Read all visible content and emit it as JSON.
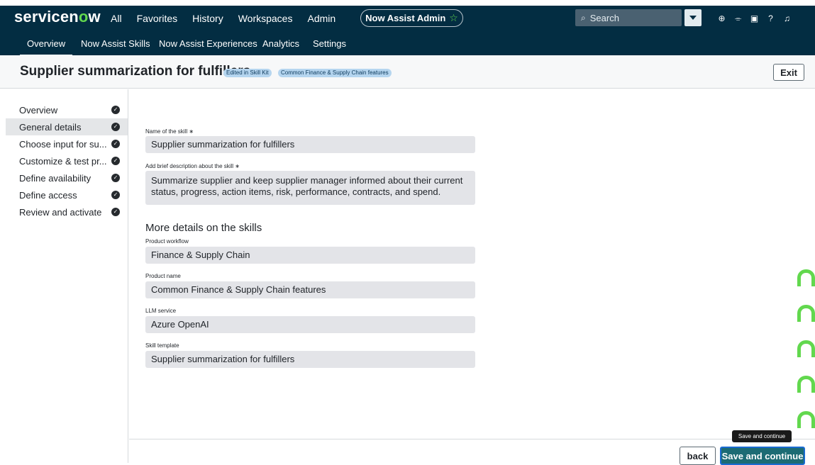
{
  "app": {
    "logo_text_a": "servicen",
    "logo_text_o": "o",
    "logo_text_b": "w",
    "nav": [
      "All",
      "Favorites",
      "History",
      "Workspaces",
      "Admin"
    ],
    "workspace_pill": "Now Assist Admin",
    "search_placeholder": "Search",
    "accent_color": "#62d84e",
    "header_bg": "#032d42"
  },
  "subnav": {
    "tabs": [
      "Overview",
      "Now Assist Skills",
      "Now Assist Experiences",
      "Analytics",
      "Settings"
    ],
    "active": "Overview"
  },
  "page": {
    "title": "Supplier summarization for fulfillers",
    "badges": [
      "Edited in Skill Kit",
      "Common Finance & Supply Chain features"
    ],
    "exit_label": "Exit"
  },
  "steps": [
    {
      "label": "Overview",
      "done": true
    },
    {
      "label": "General details",
      "done": true
    },
    {
      "label": "Choose input for su...",
      "done": true
    },
    {
      "label": "Customize & test pr...",
      "done": true
    },
    {
      "label": "Define availability",
      "done": true
    },
    {
      "label": "Define access",
      "done": true
    },
    {
      "label": "Review and activate",
      "done": true
    }
  ],
  "active_step": "General details",
  "form": {
    "name_label": "Name of the skill ∗",
    "name_value": "Supplier summarization for fulfillers",
    "desc_label": "Add brief description about the skill ∗",
    "desc_value": "Summarize supplier and keep supplier manager informed about their current status, progress, action items, risk, performance, contracts, and spend.",
    "section_title": "More details on the skills",
    "workflow_label": "Product workflow",
    "workflow_value": "Finance & Supply Chain",
    "product_label": "Product name",
    "product_value": "Common Finance & Supply Chain features",
    "llm_label": "LLM service",
    "llm_value": "Azure OpenAI",
    "template_label": "Skill template",
    "template_value": "Supplier summarization for fulfillers"
  },
  "footer": {
    "back_label": "back",
    "save_label": "Save and continue",
    "tooltip": "Save and continue"
  }
}
